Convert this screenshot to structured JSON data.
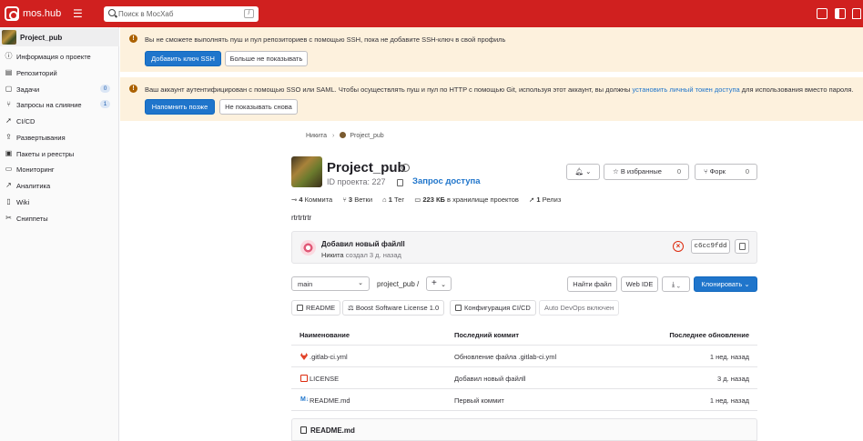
{
  "topbar": {
    "brand": "mos.hub",
    "search_placeholder": "Поиск в МосХаб",
    "search_shortcut": "/"
  },
  "sidebar": {
    "project_name": "Project_pub",
    "items": [
      {
        "label": "Информация о проекте",
        "icon": "info-icon"
      },
      {
        "label": "Репозиторий",
        "icon": "repository-icon"
      },
      {
        "label": "Задачи",
        "icon": "issues-icon",
        "count": "0"
      },
      {
        "label": "Запросы на слияние",
        "icon": "merge-request-icon",
        "count": "1"
      },
      {
        "label": "CI/CD",
        "icon": "rocket-icon"
      },
      {
        "label": "Развертывания",
        "icon": "deployments-icon"
      },
      {
        "label": "Пакеты и реестры",
        "icon": "package-icon"
      },
      {
        "label": "Мониторинг",
        "icon": "monitor-icon"
      },
      {
        "label": "Аналитика",
        "icon": "analytics-icon"
      },
      {
        "label": "Wiki",
        "icon": "book-icon"
      },
      {
        "label": "Сниппеты",
        "icon": "snippet-icon"
      }
    ]
  },
  "alerts": {
    "ssh": {
      "text": "Вы не сможете выполнять пуш и пул репозиториев с помощью SSH, пока не добавите SSH-ключ в свой профиль",
      "primary": "Добавить ключ SSH",
      "secondary": "Больше не показывать"
    },
    "sso": {
      "text_before": "Ваш аккаунт аутентифицирован с помощью SSO или SAML. Чтобы осуществлять пуш и пул по HTTP с помощью Git, используя этот аккаунт, вы должны ",
      "link": "установить личный токен доступа",
      "text_after": " для использования вместо пароля.",
      "primary": "Напомнить позже",
      "secondary": "Не показывать снова"
    }
  },
  "breadcrumb": [
    "Никита",
    "Project_pub"
  ],
  "project": {
    "title": "Project_pub",
    "id_label": "ID проекта: 227",
    "request_access": "Запрос доступа",
    "description": "rtrtrtrtr",
    "stats": {
      "commits_num": "4",
      "commits_label": "Коммита",
      "branches_num": "3",
      "branches_label": "Ветки",
      "tags_num": "1",
      "tags_label": "Тег",
      "storage_num": "223 КБ",
      "storage_label": "в хранилище проектов",
      "releases_num": "1",
      "releases_label": "Релиз"
    },
    "actions": {
      "star_label": "В избранные",
      "star_count": "0",
      "fork_label": "Форк",
      "fork_count": "0"
    }
  },
  "commit": {
    "title": "Добавил новый файлll",
    "author": "Никита",
    "meta": "создал 3 д. назад",
    "sha": "c6cc9fdd",
    "status": "failed"
  },
  "repo": {
    "branch": "main",
    "path": "project_pub",
    "path_sep": "/",
    "buttons": {
      "find_file": "Найти файл",
      "web_ide": "Web IDE",
      "clone": "Клонировать"
    },
    "badges": [
      "README",
      "Boost Software License 1.0",
      "Конфигурация CI/CD",
      "Auto DevOps включен"
    ]
  },
  "table": {
    "headers": [
      "Наименование",
      "Последний коммит",
      "Последнее обновление"
    ],
    "rows": [
      {
        "name": ".gitlab-ci.yml",
        "commit": "Обновление файла .gitlab-ci.yml",
        "updated": "1 нед. назад",
        "icon": "gitlab-icon"
      },
      {
        "name": "LICENSE",
        "commit": "Добавил новый файлll",
        "updated": "3 д. назад",
        "icon": "license-icon"
      },
      {
        "name": "README.md",
        "commit": "Первый коммит",
        "updated": "1 нед. назад",
        "icon": "markdown-icon"
      }
    ]
  },
  "readme_title": "README.md",
  "colors": {
    "topbar": "#d0201f",
    "primary": "#1f75cb",
    "alert_bg": "#fdf1dd",
    "danger": "#dd2b0e"
  }
}
